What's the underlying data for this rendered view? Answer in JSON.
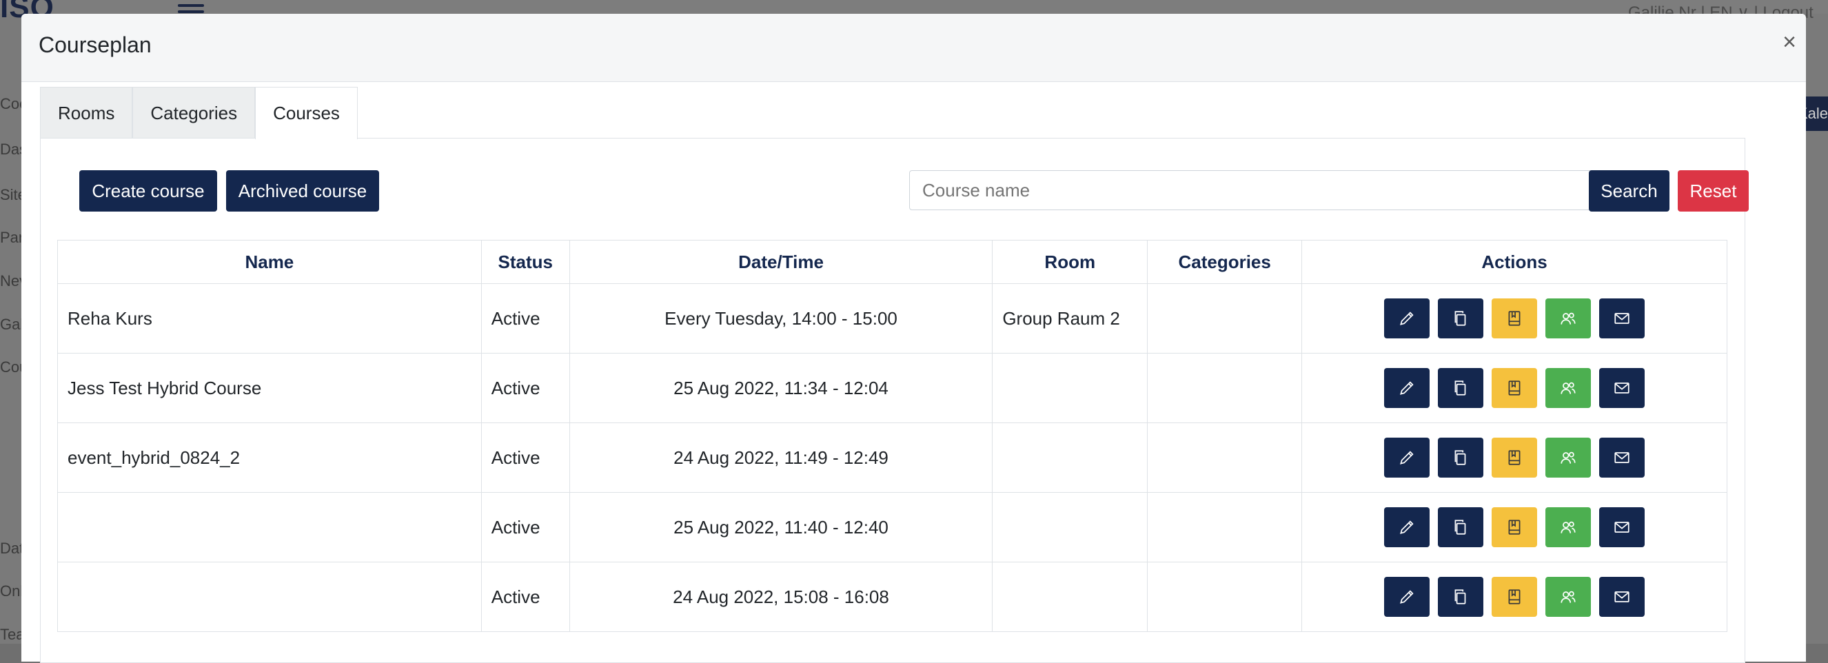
{
  "background": {
    "logo": "ISO",
    "userbar": "Galilie Nr | EN ∨ | Logout",
    "side_items": [
      "Coo",
      "Das",
      "Site",
      "Par",
      "Nev",
      "Gal",
      "Cou",
      "Dat",
      "Onl",
      "Tea"
    ],
    "right_button": "Kalen"
  },
  "modal": {
    "title": "Courseplan",
    "close": "×"
  },
  "tabs": [
    {
      "label": "Rooms",
      "active": false
    },
    {
      "label": "Categories",
      "active": false
    },
    {
      "label": "Courses",
      "active": true
    }
  ],
  "toolbar": {
    "create_label": "Create course",
    "archived_label": "Archived course",
    "search_placeholder": "Course name",
    "search_label": "Search",
    "reset_label": "Reset"
  },
  "table": {
    "headers": [
      "Name",
      "Status",
      "Date/Time",
      "Room",
      "Categories",
      "Actions"
    ],
    "rows": [
      {
        "name": "Reha Kurs",
        "status": "Active",
        "datetime": "Every Tuesday, 14:00 - 15:00",
        "room": "Group Raum 2",
        "categories": ""
      },
      {
        "name": "Jess Test Hybrid Course",
        "status": "Active",
        "datetime": "25 Aug 2022, 11:34 - 12:04",
        "room": "",
        "categories": ""
      },
      {
        "name": "event_hybrid_0824_2",
        "status": "Active",
        "datetime": "24 Aug 2022, 11:49 - 12:49",
        "room": "",
        "categories": ""
      },
      {
        "name": "",
        "status": "Active",
        "datetime": "25 Aug 2022, 11:40 - 12:40",
        "room": "",
        "categories": ""
      },
      {
        "name": "",
        "status": "Active",
        "datetime": "24 Aug 2022, 15:08 - 16:08",
        "room": "",
        "categories": ""
      }
    ],
    "action_icons": [
      "pencil-icon",
      "copy-icon",
      "book-icon",
      "users-icon",
      "envelope-icon"
    ]
  },
  "colors": {
    "navy": "#14274e",
    "red": "#dc3545",
    "yellow": "#f5c13d",
    "green": "#4caf50"
  }
}
